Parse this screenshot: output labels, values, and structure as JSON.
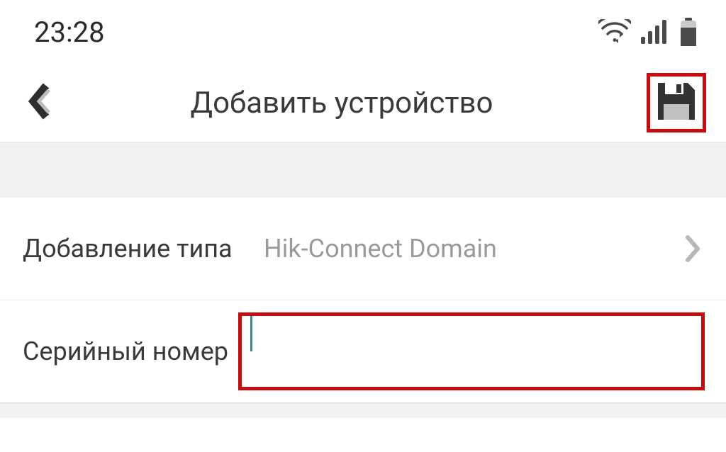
{
  "status_bar": {
    "time": "23:28"
  },
  "header": {
    "title": "Добавить устройство"
  },
  "form": {
    "add_type": {
      "label": "Добавление типа",
      "value": "Hik-Connect Domain"
    },
    "serial": {
      "label": "Серийный номер",
      "value": ""
    }
  }
}
